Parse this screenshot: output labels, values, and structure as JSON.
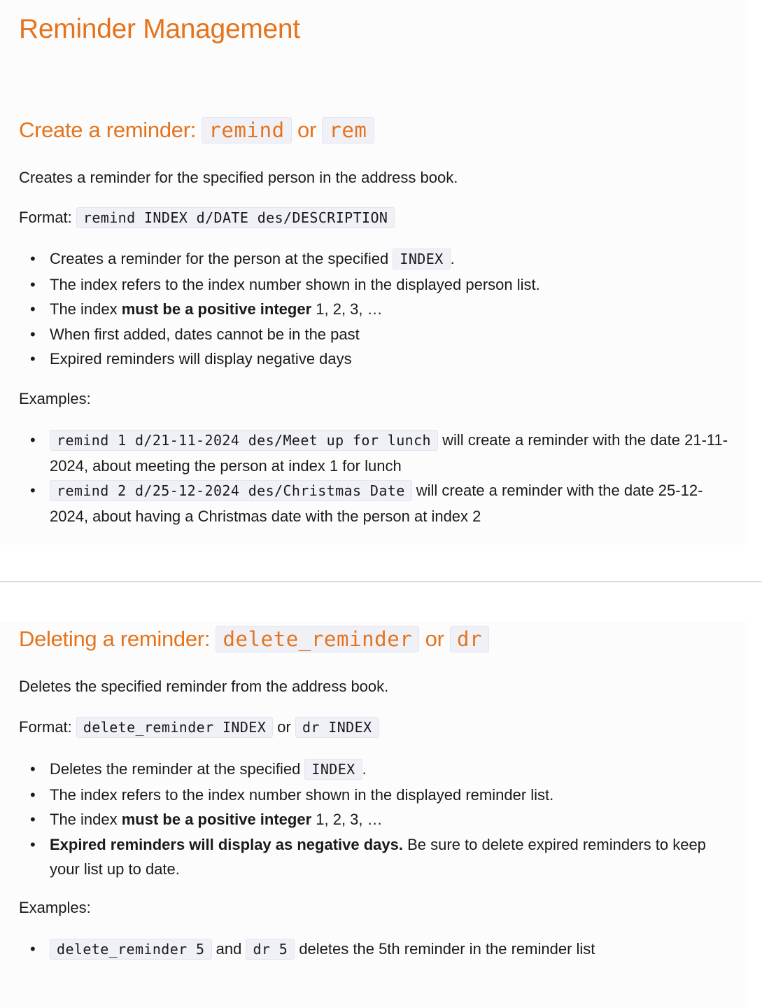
{
  "title": "Reminder Management",
  "create": {
    "heading_text": "Create a reminder: ",
    "cmd1": "remind",
    "or": " or ",
    "cmd2": "rem",
    "description": "Creates a reminder for the specified person in the address book.",
    "format_label": "Format: ",
    "format_code": "remind INDEX d/DATE des/DESCRIPTION",
    "bullets": {
      "b1_text": "Creates a reminder for the person at the specified ",
      "b1_code": "INDEX",
      "b1_end": ".",
      "b2": "The index refers to the index number shown in the displayed person list.",
      "b3_pre": "The index ",
      "b3_bold": "must be a positive integer",
      "b3_post": " 1, 2, 3, …",
      "b4": "When first added, dates cannot be in the past",
      "b5": "Expired reminders will display negative days"
    },
    "examples_label": "Examples:",
    "examples": {
      "e1_code": "remind 1 d/21-11-2024 des/Meet up for lunch",
      "e1_text": " will create a reminder with the date 21-11-2024, about meeting the person at index 1 for lunch",
      "e2_code": "remind 2 d/25-12-2024 des/Christmas Date",
      "e2_text": " will create a reminder with the date 25-12-2024, about having a Christmas date with the person at index 2"
    }
  },
  "delete": {
    "heading_text": "Deleting a reminder: ",
    "cmd1": "delete_reminder",
    "or": " or ",
    "cmd2": "dr",
    "description": "Deletes the specified reminder from the address book.",
    "format_label": "Format: ",
    "format_code1": "delete_reminder INDEX",
    "format_or": " or ",
    "format_code2": "dr INDEX",
    "bullets": {
      "b1_text": "Deletes the reminder at the specified ",
      "b1_code": "INDEX",
      "b1_end": ".",
      "b2": "The index refers to the index number shown in the displayed reminder list.",
      "b3_pre": "The index ",
      "b3_bold": "must be a positive integer",
      "b3_post": " 1, 2, 3, …",
      "b4_bold": "Expired reminders will display as negative days.",
      "b4_text": " Be sure to delete expired reminders to keep your list up to date."
    },
    "examples_label": "Examples:",
    "examples": {
      "e1_code1": "delete_reminder 5",
      "e1_and": " and ",
      "e1_code2": "dr 5",
      "e1_text": " deletes the 5th reminder in the reminder list"
    }
  },
  "colors": {
    "heading": "#e5731b",
    "code_bg": "#f0f0f7"
  }
}
